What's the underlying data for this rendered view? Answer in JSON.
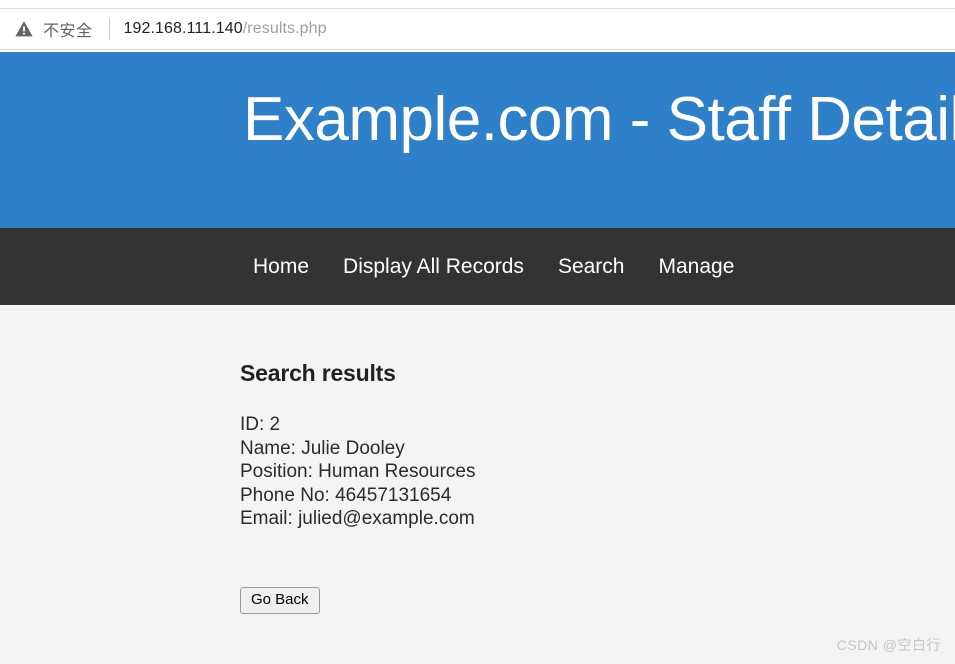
{
  "browser": {
    "security_icon": "warning-triangle-icon",
    "security_label": "不安全",
    "url_host": "192.168.111.140",
    "url_path": "/results.php",
    "url_full": "192.168.111.140/results.php"
  },
  "page": {
    "title": "Example.com - Staff Details",
    "header_color": "#2e80c8",
    "nav_color": "#333333",
    "body_color": "#f4f4f4"
  },
  "nav": {
    "items": [
      {
        "label": "Home"
      },
      {
        "label": "Display All Records"
      },
      {
        "label": "Search"
      },
      {
        "label": "Manage"
      }
    ]
  },
  "results": {
    "heading": "Search results",
    "record": {
      "id_line": "ID: 2",
      "name_line": "Name: Julie Dooley",
      "position_line": "Position: Human Resources",
      "phone_line": "Phone No: 46457131654",
      "email_line": "Email: julied@example.com"
    },
    "fields": {
      "id": "2",
      "name": "Julie Dooley",
      "position": "Human Resources",
      "phone": "46457131654",
      "email": "julied@example.com"
    },
    "go_back_label": "Go Back"
  },
  "watermark": {
    "text": "CSDN @空白行"
  }
}
